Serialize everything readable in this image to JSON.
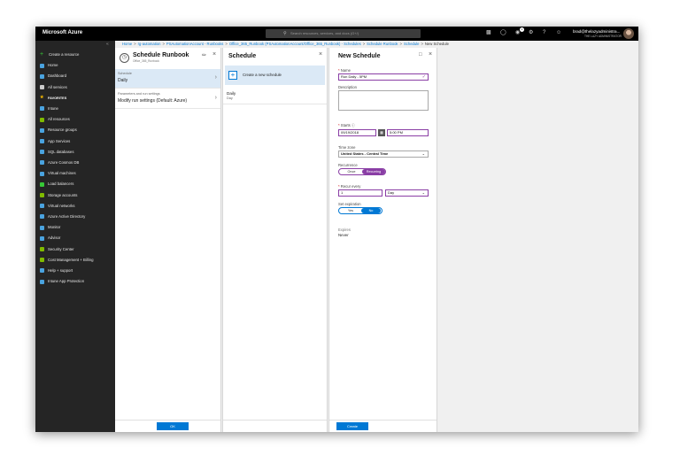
{
  "app": {
    "brand": "Microsoft Azure",
    "search_placeholder": "Search resources, services, and docs (G+/)",
    "user_email": "brad@thelazyadministra...",
    "user_org": "THE LAZY ADMINISTRATOR",
    "notification_count": "1"
  },
  "sidebar": {
    "collapse": "«",
    "items": [
      {
        "label": "Create a resource",
        "icon": "plus-icon",
        "color": "#37c837"
      },
      {
        "label": "Home",
        "icon": "home-icon",
        "color": "#4aa3df"
      },
      {
        "label": "Dashboard",
        "icon": "dashboard-icon",
        "color": "#4aa3df"
      },
      {
        "label": "All services",
        "icon": "list-icon",
        "color": "#cccccc"
      },
      {
        "label": "FAVORITES",
        "icon": "star-icon",
        "color": "#f5b800"
      },
      {
        "label": "Intune",
        "icon": "intune-icon",
        "color": "#4aa3df"
      },
      {
        "label": "All resources",
        "icon": "grid-icon",
        "color": "#7fba00"
      },
      {
        "label": "Resource groups",
        "icon": "resource-groups-icon",
        "color": "#4aa3df"
      },
      {
        "label": "App Services",
        "icon": "app-services-icon",
        "color": "#4aa3df"
      },
      {
        "label": "SQL databases",
        "icon": "sql-icon",
        "color": "#4aa3df"
      },
      {
        "label": "Azure Cosmos DB",
        "icon": "cosmos-icon",
        "color": "#4aa3df"
      },
      {
        "label": "Virtual machines",
        "icon": "vm-icon",
        "color": "#4aa3df"
      },
      {
        "label": "Load balancers",
        "icon": "load-balancer-icon",
        "color": "#37c837"
      },
      {
        "label": "Storage accounts",
        "icon": "storage-icon",
        "color": "#7fba00"
      },
      {
        "label": "Virtual networks",
        "icon": "vnet-icon",
        "color": "#4aa3df"
      },
      {
        "label": "Azure Active Directory",
        "icon": "aad-icon",
        "color": "#4aa3df"
      },
      {
        "label": "Monitor",
        "icon": "monitor-icon",
        "color": "#4aa3df"
      },
      {
        "label": "Advisor",
        "icon": "advisor-icon",
        "color": "#4aa3df"
      },
      {
        "label": "Security Center",
        "icon": "shield-icon",
        "color": "#7fba00"
      },
      {
        "label": "Cost Management + Billing",
        "icon": "cost-icon",
        "color": "#7fba00"
      },
      {
        "label": "Help + support",
        "icon": "help-icon",
        "color": "#4aa3df"
      },
      {
        "label": "Intune App Protection",
        "icon": "app-protection-icon",
        "color": "#4aa3df"
      }
    ]
  },
  "breadcrumb": {
    "items": [
      "Home",
      "rg-automation",
      "PSAutomationAccount - Runbooks",
      "Office_365_Runbook (PSAutomationAccount/Office_365_Runbook) - Schedules",
      "Schedule Runbook",
      "Schedule"
    ],
    "current": "New Schedule"
  },
  "blade1": {
    "title": "Schedule Runbook",
    "subtitle": "Office_365_Runbook",
    "schedule_label": "Schedule",
    "schedule_value": "Daily",
    "params_label": "Parameters and run settings",
    "params_value": "Modify run settings (Default: Azure)",
    "ok_label": "OK"
  },
  "blade2": {
    "title": "Schedule",
    "create_label": "Create a new schedule",
    "item_name": "Daily",
    "item_sub": "Day"
  },
  "blade3": {
    "title": "New Schedule",
    "name_label": "Name",
    "name_value": "Run Daily - 5PM",
    "description_label": "Description",
    "starts_label": "Starts",
    "start_date": "09/19/2018",
    "start_time": "5:00 PM",
    "timezone_label": "Time zone",
    "timezone_value": "United States - Central Time",
    "recurrence_label": "Recurrence",
    "recurrence_once": "Once",
    "recurrence_recurring": "Recurring",
    "recur_every_label": "Recur every",
    "recur_every_value": "1",
    "recur_unit": "Day",
    "expiration_label": "Set expiration",
    "expiration_yes": "Yes",
    "expiration_no": "No",
    "expires_label": "Expires",
    "expires_value": "Never",
    "create_label": "Create"
  }
}
